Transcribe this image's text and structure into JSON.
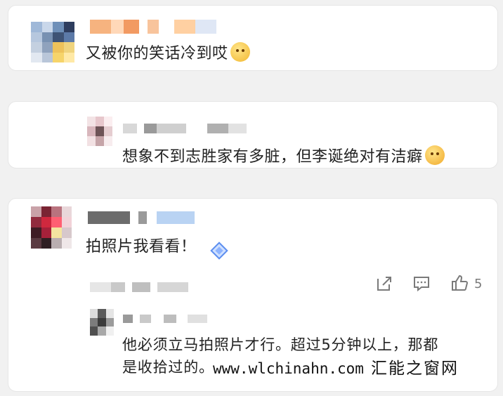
{
  "comments": [
    {
      "text": "又被你的笑话冷到哎",
      "emoji": "shushing-face-emoji"
    },
    {
      "text": "想象不到志胜家有多脏，但李诞绝对有洁癖",
      "emoji": "laughing-tears-emoji"
    },
    {
      "text": "拍照片我看看！",
      "actions": {
        "like_count": "5"
      }
    }
  ],
  "reply": {
    "text_line1": "他必须立马拍照片才行。超过5分钟以上，那都",
    "text_line2": "是收拾过的。"
  },
  "watermark": {
    "url": "www.wlchinahn.com",
    "site": "汇能之窗网"
  },
  "colors": {
    "background": "#f1f1f1",
    "card": "#ffffff",
    "icon": "#7a7a7a"
  }
}
